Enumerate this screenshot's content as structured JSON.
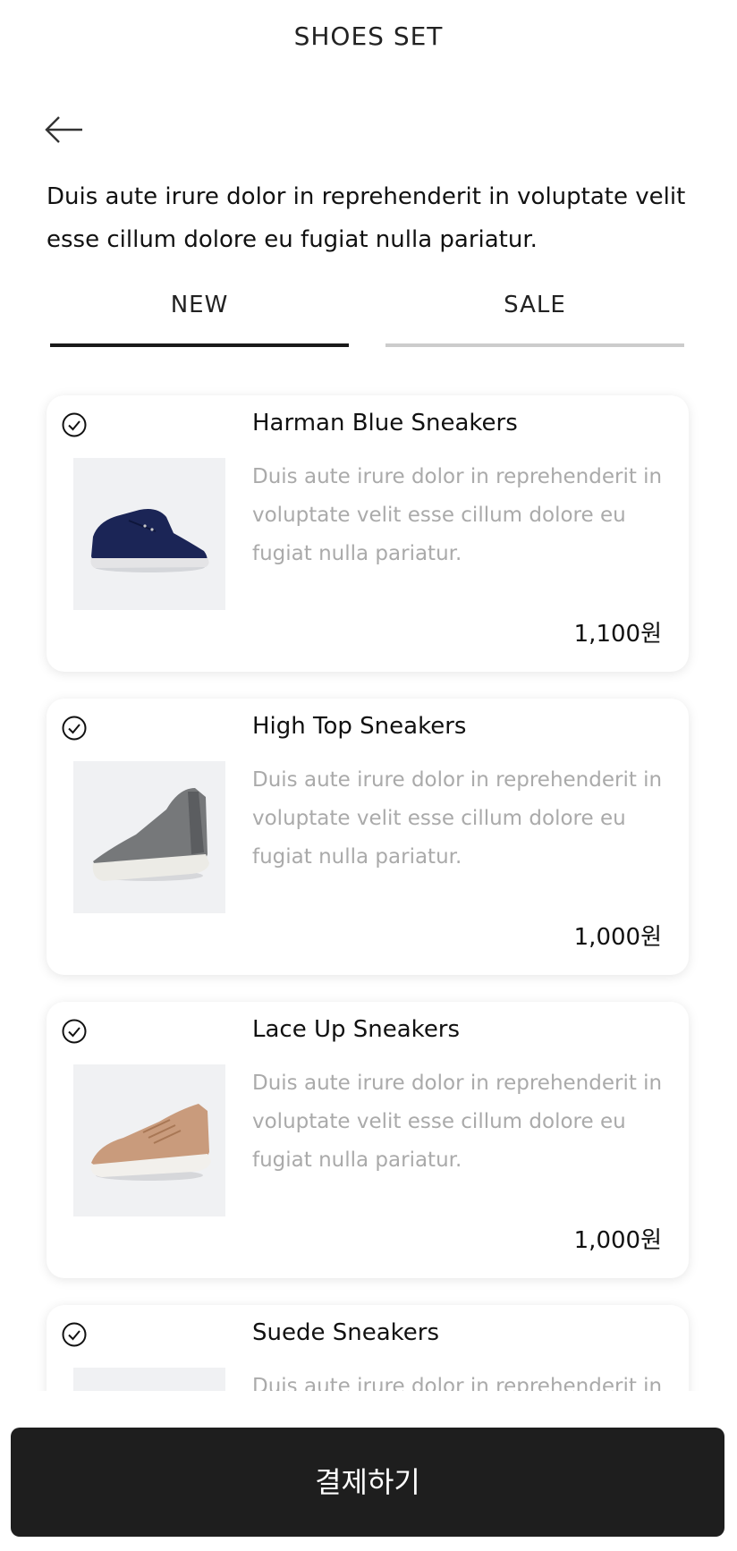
{
  "header": {
    "title": "SHOES SET",
    "back_icon": "arrow-left-icon"
  },
  "intro_text": "Duis aute irure dolor in reprehenderit in voluptate velit esse cillum dolore eu fugiat nulla pariatur.",
  "tabs": [
    {
      "label": "NEW",
      "active": true
    },
    {
      "label": "SALE",
      "active": false
    }
  ],
  "colors": {
    "tab_active": "#1a1a1a",
    "tab_inactive": "#cccccc",
    "button_bg": "#1e1e1e",
    "thumb_bg": "#f0f1f3",
    "desc_text": "#aaaaaa"
  },
  "products": [
    {
      "name": "Harman Blue Sneakers",
      "description": "Duis aute irure dolor in reprehenderit in voluptate velit esse cillum dolore eu fugiat nulla pariatur.",
      "price": "1,100원",
      "image": "navy-suede-chukka-boot"
    },
    {
      "name": "High Top Sneakers",
      "description": "Duis aute irure dolor in reprehenderit in voluptate velit esse cillum dolore eu fugiat nulla pariatur.",
      "price": "1,000원",
      "image": "grey-suede-chelsea-sneaker"
    },
    {
      "name": "Lace Up Sneakers",
      "description": "Duis aute irure dolor in reprehenderit in voluptate velit esse cillum dolore eu fugiat nulla pariatur.",
      "price": "1,000원",
      "image": "tan-suede-lace-up-sneaker"
    },
    {
      "name": "Suede Sneakers",
      "description": "Duis aute irure dolor in reprehenderit in voluptate velit esse cillum dolore eu fugiat nulla pariatur.",
      "price": "",
      "image": ""
    }
  ],
  "checkout_button": "결제하기"
}
